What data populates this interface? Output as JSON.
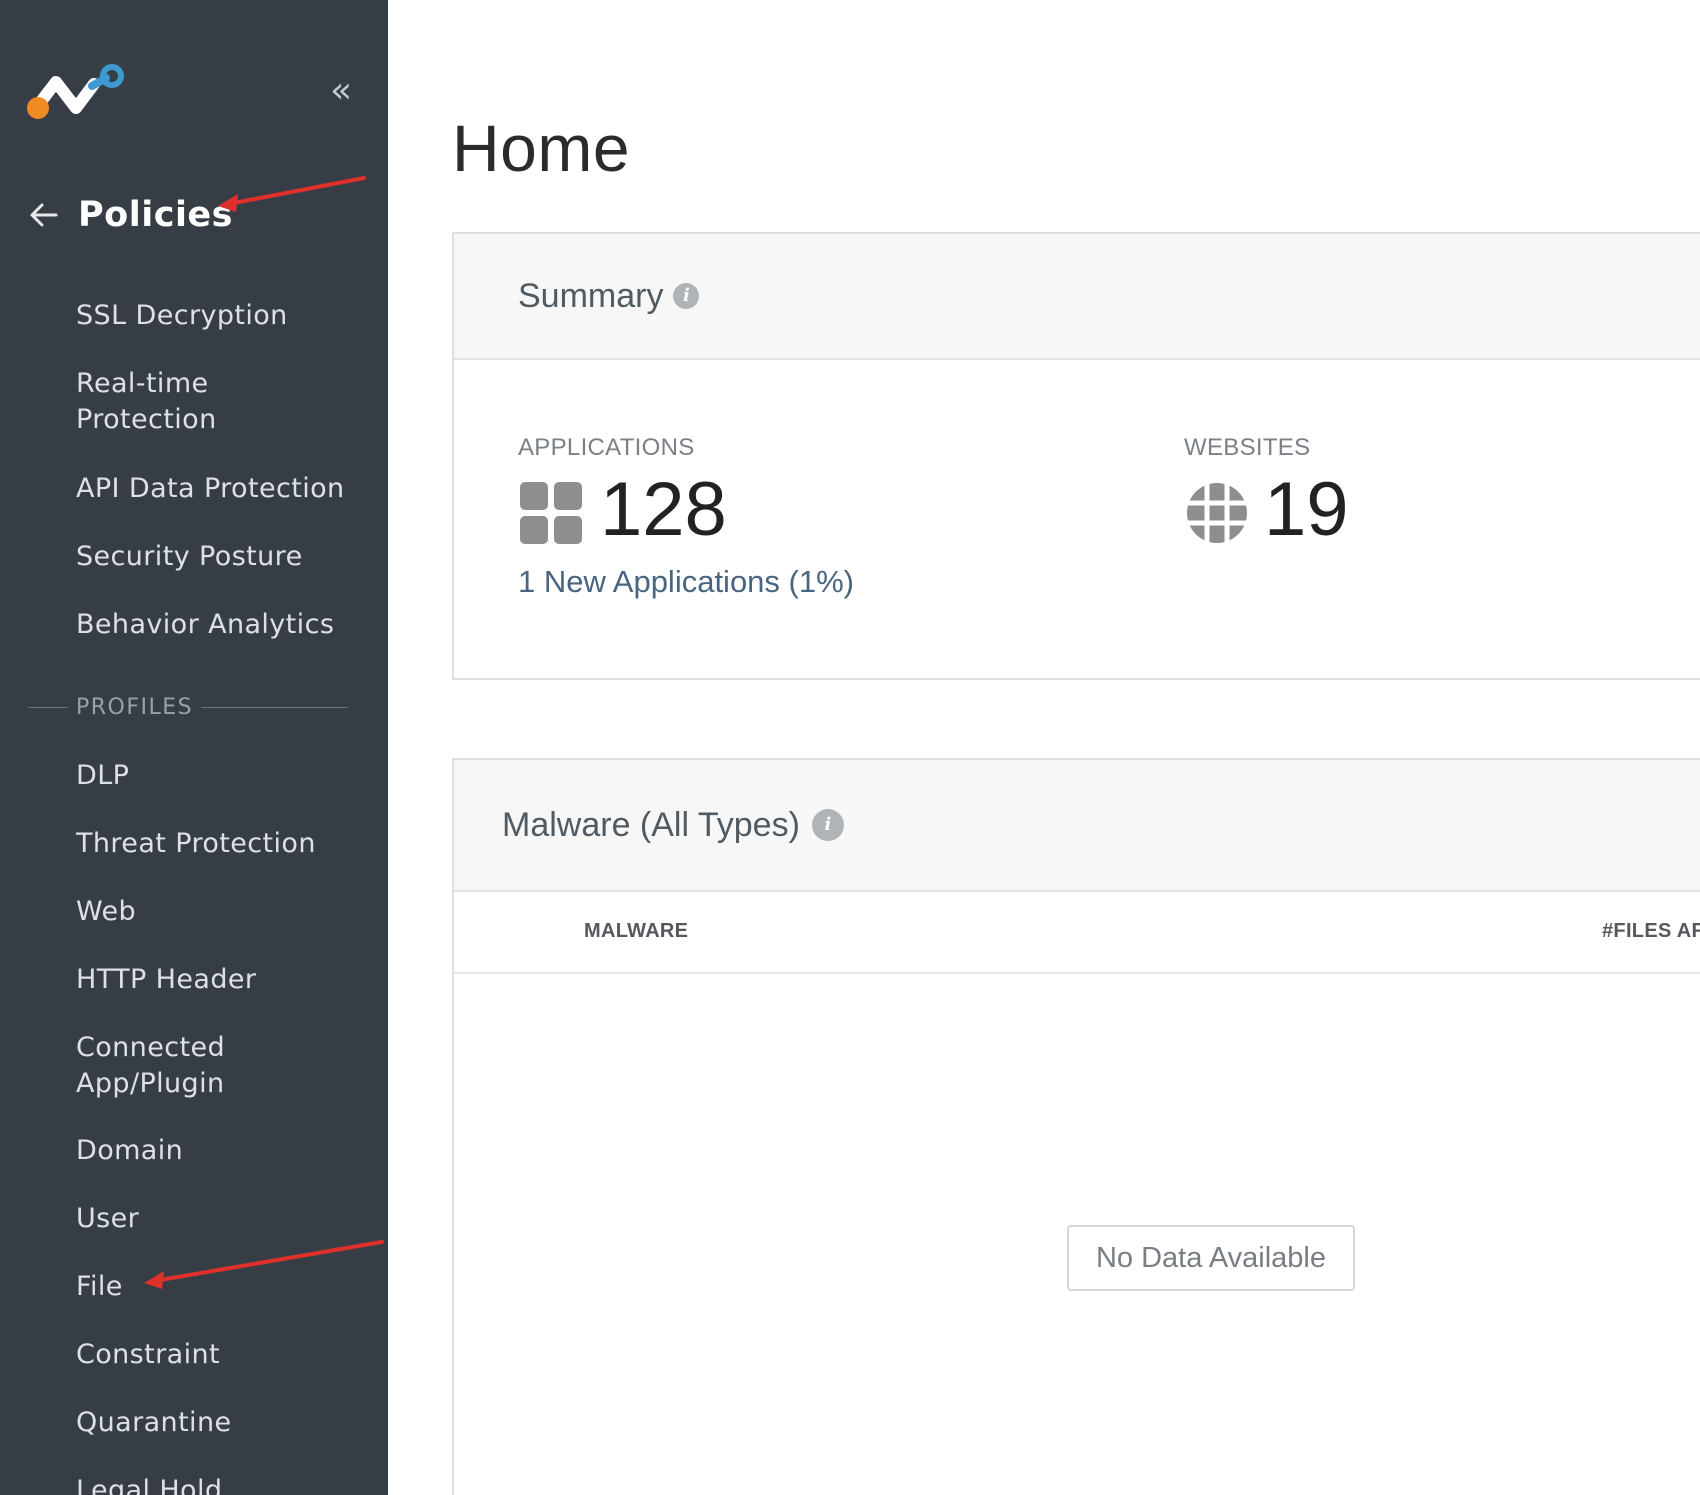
{
  "sidebar": {
    "section_title": "Policies",
    "items": [
      "SSL Decryption",
      "Real-time Protection",
      "API Data Protection",
      "Security Posture",
      "Behavior Analytics"
    ],
    "profiles_label": "PROFILES",
    "profile_items": [
      "DLP",
      "Threat Protection",
      "Web",
      "HTTP Header",
      "Connected App/Plugin",
      "Domain",
      "User",
      "File",
      "Constraint",
      "Quarantine",
      "Legal Hold"
    ]
  },
  "page": {
    "title": "Home"
  },
  "summary": {
    "title": "Summary",
    "applications": {
      "label": "APPLICATIONS",
      "value": "128",
      "link": "1 New Applications (1%)"
    },
    "websites": {
      "label": "WEBSITES",
      "value": "19"
    }
  },
  "malware": {
    "title": "Malware (All Types)",
    "columns": [
      "MALWARE",
      "#FILES AFF"
    ],
    "empty_text": "No Data Available"
  },
  "colors": {
    "sidebar_bg": "#363d45",
    "logo_orange": "#f08a24",
    "logo_blue": "#3d9ad1",
    "annotation_arrow": "#e0302b"
  }
}
